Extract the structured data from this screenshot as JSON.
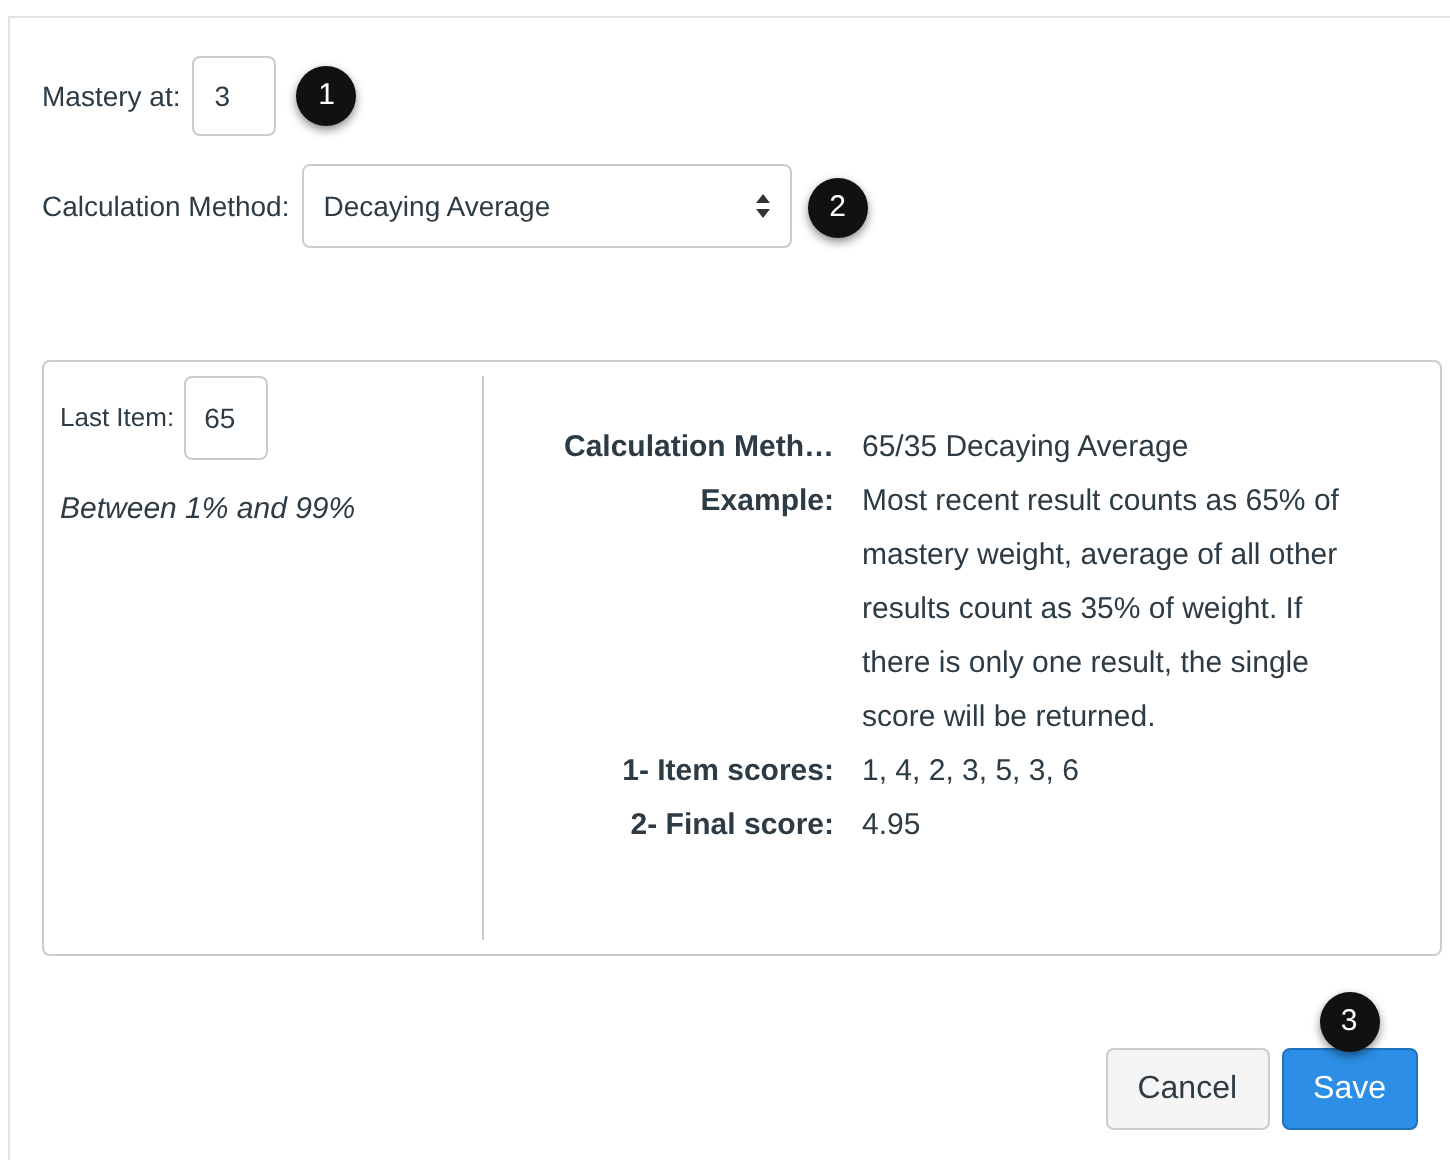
{
  "mastery": {
    "label": "Mastery at:",
    "value": "3",
    "callout": "1"
  },
  "calculation_method": {
    "label": "Calculation Method:",
    "value": "Decaying Average",
    "callout": "2"
  },
  "details": {
    "last_item": {
      "label": "Last Item:",
      "value": "65"
    },
    "hint": "Between 1% and 99%",
    "rows": [
      {
        "label": "Calculation Meth…",
        "value": "65/35 Decaying Average"
      },
      {
        "label": "Example:",
        "value": "Most recent result counts as 65% of mastery weight, average of all other results count as 35% of weight. If there is only one result, the single score will be returned."
      },
      {
        "label": "1- Item scores:",
        "value": "1, 4, 2, 3, 5, 3, 6"
      },
      {
        "label": "2- Final score:",
        "value": "4.95"
      }
    ]
  },
  "buttons": [
    {
      "label": "Cancel",
      "kind": "secondary"
    },
    {
      "label": "Save",
      "kind": "primary",
      "callout": "3"
    }
  ]
}
